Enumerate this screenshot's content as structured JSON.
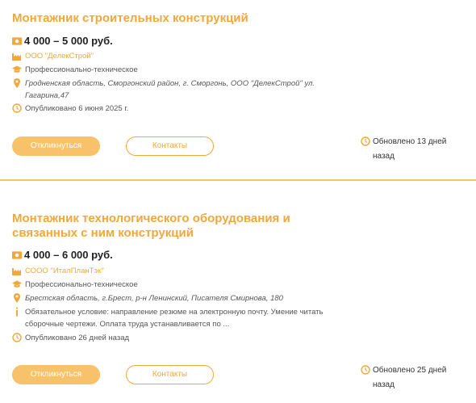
{
  "colors": {
    "accent": "#f1a83a",
    "button_fill": "#f7c26a",
    "divider": "#f4c46c"
  },
  "vacancies": [
    {
      "title": "Монтажник строительных конструкций",
      "salary": "4 000 – 5 000 руб.",
      "company": "ООО \"ДелекСтрой\"",
      "education": "Профессионально-техническое",
      "address": "Гродненская область, Сморгонский район, г. Сморгонь, ООО \"ДелекСтрой\" ул. Гагарина,47",
      "published": "Опубликовано 6 июня 2025 г.",
      "respond_label": "Откликнуться",
      "contacts_label": "Контакты",
      "updated": "Обновлено 13 дней назад"
    },
    {
      "title": "Монтажник технологического оборудования и связанных с ним конструкций",
      "salary": "4 000 – 6 000 руб.",
      "company": "СООО \"ИталПланТэк\"",
      "education": "Профессионально-техническое",
      "address": "Брестская область, г.Брест, р-н Ленинский, Писателя Смирнова, 180",
      "info": "Обязательное условие: направление резюме на электронную почту. Умение читать сборочные чертежи. Оплата труда устанавливается по ...",
      "published": "Опубликовано 26 дней назад",
      "respond_label": "Откликнуться",
      "contacts_label": "Контакты",
      "updated": "Обновлено 25 дней назад"
    }
  ],
  "icons": [
    "money-icon",
    "factory-icon",
    "graduation-cap-icon",
    "location-pin-icon",
    "info-icon",
    "clock-icon"
  ]
}
